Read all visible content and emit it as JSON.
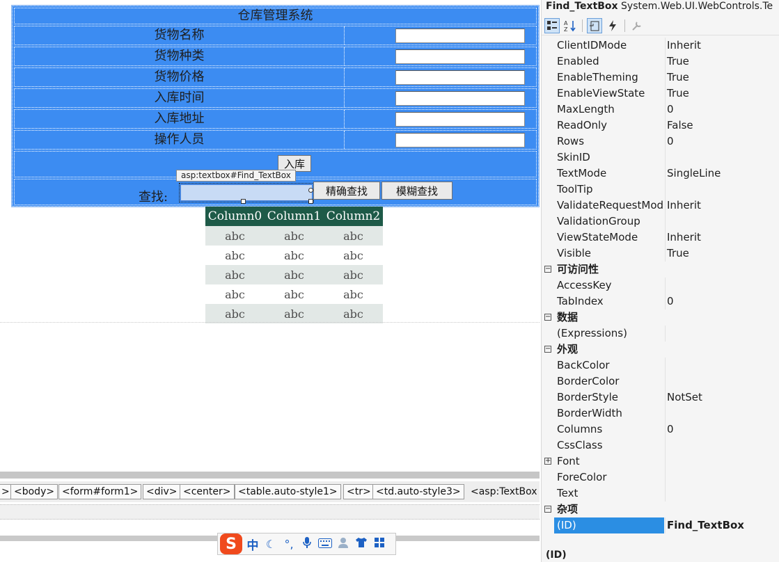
{
  "form": {
    "title": "仓库管理系统",
    "fields": [
      {
        "label": "货物名称",
        "value": ""
      },
      {
        "label": "货物种类",
        "value": ""
      },
      {
        "label": "货物价格",
        "value": ""
      },
      {
        "label": "入库时间",
        "value": ""
      },
      {
        "label": "入库地址",
        "value": ""
      },
      {
        "label": "操作人员",
        "value": ""
      }
    ],
    "submit_label": "入库",
    "find_label": "查找:",
    "find_value": "",
    "exact_search_label": "精确查找",
    "fuzzy_search_label": "模糊查找",
    "selection_tag": "asp:textbox#Find_TextBox"
  },
  "grid": {
    "columns": [
      "Column0",
      "Column1",
      "Column2"
    ],
    "rows": [
      [
        "abc",
        "abc",
        "abc"
      ],
      [
        "abc",
        "abc",
        "abc"
      ],
      [
        "abc",
        "abc",
        "abc"
      ],
      [
        "abc",
        "abc",
        "abc"
      ],
      [
        "abc",
        "abc",
        "abc"
      ]
    ]
  },
  "tagbar": {
    "tags": [
      ">",
      "<body>",
      "<form#form1>",
      "<div>",
      "<center>",
      "<table.auto-style1>",
      "<tr>",
      "<td.auto-style3>",
      "<asp:TextBox"
    ]
  },
  "ime": {
    "logo": "S",
    "mode": "中",
    "icons": [
      "moon-icon",
      "punctuation-icon",
      "microphone-icon",
      "keyboard-icon",
      "user-icon",
      "shirt-icon",
      "grid-icon"
    ]
  },
  "properties": {
    "object_name": "Find_TextBox",
    "object_type": "System.Web.UI.WebControls.Te",
    "rows": [
      {
        "kind": "prop",
        "name": "ClientIDMode",
        "value": "Inherit"
      },
      {
        "kind": "prop",
        "name": "Enabled",
        "value": "True"
      },
      {
        "kind": "prop",
        "name": "EnableTheming",
        "value": "True"
      },
      {
        "kind": "prop",
        "name": "EnableViewState",
        "value": "True"
      },
      {
        "kind": "prop",
        "name": "MaxLength",
        "value": "0"
      },
      {
        "kind": "prop",
        "name": "ReadOnly",
        "value": "False"
      },
      {
        "kind": "prop",
        "name": "Rows",
        "value": "0"
      },
      {
        "kind": "prop",
        "name": "SkinID",
        "value": ""
      },
      {
        "kind": "prop",
        "name": "TextMode",
        "value": "SingleLine"
      },
      {
        "kind": "prop",
        "name": "ToolTip",
        "value": ""
      },
      {
        "kind": "prop",
        "name": "ValidateRequestMod",
        "value": "Inherit"
      },
      {
        "kind": "prop",
        "name": "ValidationGroup",
        "value": ""
      },
      {
        "kind": "prop",
        "name": "ViewStateMode",
        "value": "Inherit"
      },
      {
        "kind": "prop",
        "name": "Visible",
        "value": "True"
      },
      {
        "kind": "cat",
        "name": "可访问性",
        "value": ""
      },
      {
        "kind": "prop",
        "name": "AccessKey",
        "value": ""
      },
      {
        "kind": "prop",
        "name": "TabIndex",
        "value": "0"
      },
      {
        "kind": "cat",
        "name": "数据",
        "value": ""
      },
      {
        "kind": "prop",
        "name": "(Expressions)",
        "value": ""
      },
      {
        "kind": "cat",
        "name": "外观",
        "value": ""
      },
      {
        "kind": "prop",
        "name": "BackColor",
        "value": ""
      },
      {
        "kind": "prop",
        "name": "BorderColor",
        "value": ""
      },
      {
        "kind": "prop",
        "name": "BorderStyle",
        "value": "NotSet"
      },
      {
        "kind": "prop",
        "name": "BorderWidth",
        "value": ""
      },
      {
        "kind": "prop",
        "name": "Columns",
        "value": "0"
      },
      {
        "kind": "prop",
        "name": "CssClass",
        "value": ""
      },
      {
        "kind": "exp",
        "name": "Font",
        "value": ""
      },
      {
        "kind": "prop",
        "name": "ForeColor",
        "value": ""
      },
      {
        "kind": "prop",
        "name": "Text",
        "value": ""
      },
      {
        "kind": "cat",
        "name": "杂项",
        "value": ""
      },
      {
        "kind": "selected",
        "name": "(ID)",
        "value": "Find_TextBox"
      }
    ],
    "description": "(ID)"
  },
  "colors": {
    "form_background": "#3c8cf2",
    "grid_header": "#1e5a48",
    "selected_row": "#2b8ee3"
  }
}
